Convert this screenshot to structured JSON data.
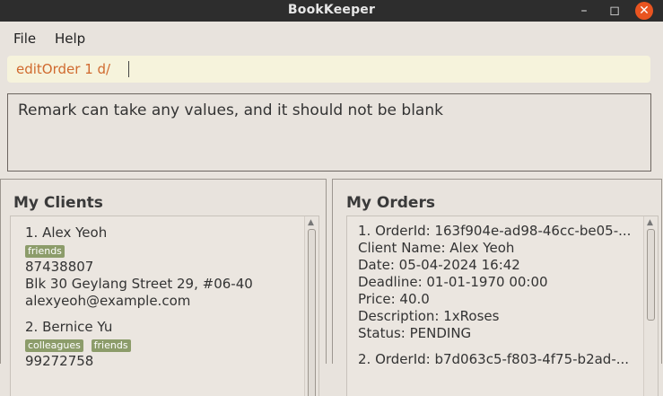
{
  "window": {
    "title": "BookKeeper"
  },
  "window_controls": {
    "minimize": "–",
    "maximize": "◻",
    "close": "✕"
  },
  "menu": {
    "file": "File",
    "help": "Help"
  },
  "command": {
    "value": "editOrder 1 d/"
  },
  "result": {
    "message": "Remark can take any values, and it should not be blank"
  },
  "clients": {
    "heading": "My Clients",
    "items": [
      {
        "title": "1.  Alex Yeoh",
        "tags": [
          "friends"
        ],
        "phone": "87438807",
        "address": "Blk 30 Geylang Street 29, #06-40",
        "email": "alexyeoh@example.com"
      },
      {
        "title": "2.  Bernice Yu",
        "tags": [
          "colleagues",
          "friends"
        ],
        "phone": "99272758"
      }
    ]
  },
  "orders": {
    "heading": "My Orders",
    "items": [
      {
        "title": "1.  OrderId: 163f904e-ad98-46cc-be05-...",
        "client": "Client Name: Alex Yeoh",
        "date": "Date: 05-04-2024 16:42",
        "deadline": "Deadline: 01-01-1970 00:00",
        "price": "Price: 40.0",
        "description": "Description: 1xRoses",
        "status": "Status: PENDING"
      },
      {
        "title": "2.  OrderId: b7d063c5-f803-4f75-b2ad-..."
      }
    ]
  }
}
